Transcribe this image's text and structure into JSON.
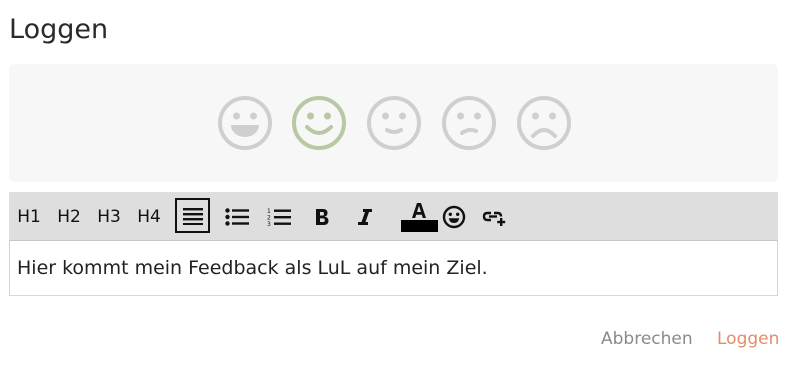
{
  "dialog": {
    "title": "Loggen"
  },
  "moods": [
    {
      "icon": "grin-face-icon",
      "selected": false
    },
    {
      "icon": "smile-face-icon",
      "selected": true
    },
    {
      "icon": "slight-smile-face-icon",
      "selected": false
    },
    {
      "icon": "neutral-face-icon",
      "selected": false
    },
    {
      "icon": "frown-face-icon",
      "selected": false
    }
  ],
  "colors": {
    "mood_default": "#cfcfcf",
    "mood_selected": "#b7c8a2",
    "accent": "#e08f6a",
    "toolbar_bg": "#dedede",
    "text_color_swatch": "#000000"
  },
  "toolbar": {
    "h1": "H1",
    "h2": "H2",
    "h3": "H3",
    "h4": "H4",
    "icons": [
      "align-justify-icon",
      "bulleted-list-icon",
      "numbered-list-icon",
      "bold-icon",
      "italic-icon",
      "text-color-icon",
      "emoji-icon",
      "insert-link-icon"
    ]
  },
  "editor": {
    "content": "Hier kommt mein Feedback als LuL auf mein Ziel."
  },
  "actions": {
    "cancel": "Abbrechen",
    "submit": "Loggen"
  }
}
